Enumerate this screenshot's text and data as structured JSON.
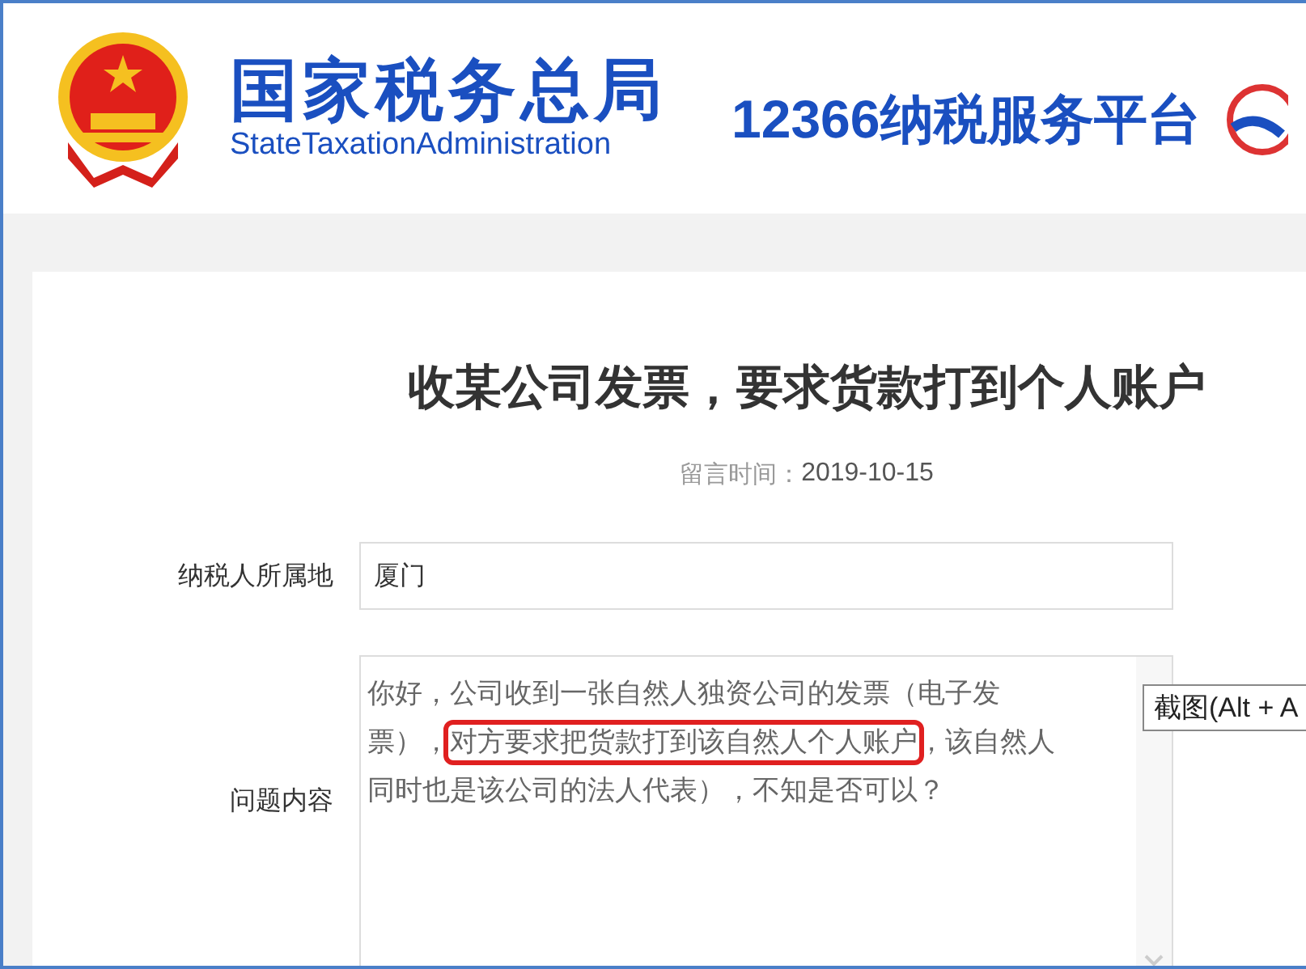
{
  "header": {
    "title": "国家税务总局",
    "subtitle": "StateTaxationAdministration",
    "service": "12366纳税服务平台"
  },
  "article": {
    "title": "收某公司发票，要求货款打到个人账户",
    "date_label": "留言时间：",
    "date": "2019-10-15"
  },
  "fields": [
    {
      "label": "纳税人所属地",
      "value": "厦门"
    }
  ],
  "question": {
    "label": "问题内容",
    "before": "你好，公司收到一张自然人独资公司的发票（电子发票），",
    "highlight": "对方要求把货款打到该自然人个人账户",
    "after": "，该自然人同时也是该公司的法人代表），不知是否可以？"
  },
  "tooltip": {
    "text": "截图(Alt + A"
  }
}
